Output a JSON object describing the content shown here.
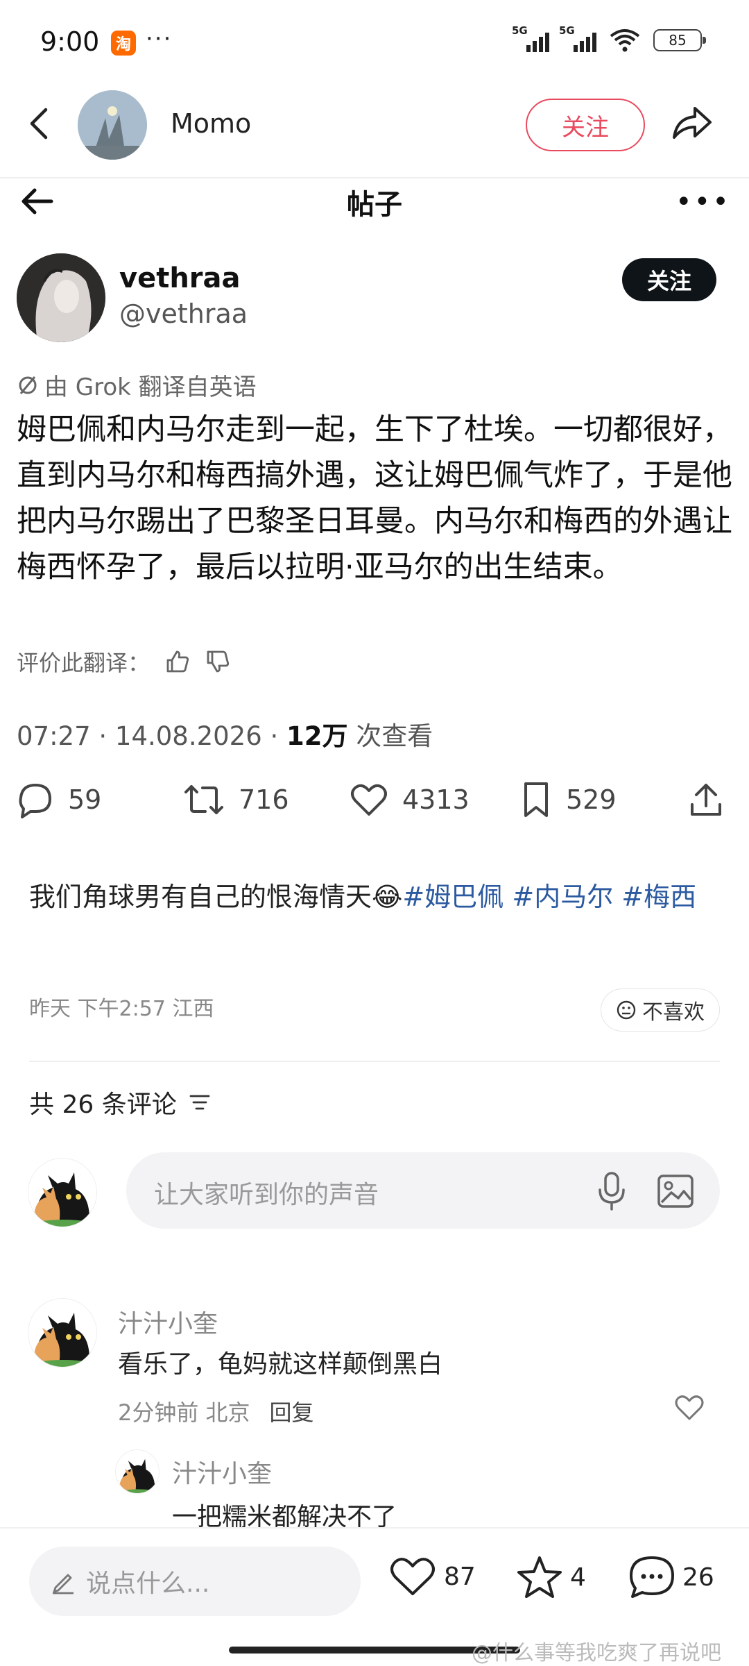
{
  "status_bar": {
    "time": "9:00",
    "app_icon_text": "淘",
    "more": "···",
    "net1": "5G",
    "net2": "5G",
    "battery": "85"
  },
  "header": {
    "name": "Momo",
    "follow_label": "关注"
  },
  "post": {
    "topbar_title": "帖子",
    "more": "•••",
    "author_name": "vethraa",
    "author_handle": "@vethraa",
    "follow_label": "关注",
    "translate_note": "由 Grok 翻译自英语",
    "body": "姆巴佩和内马尔走到一起，生下了杜埃。一切都很好，直到内马尔和梅西搞外遇，这让姆巴佩气炸了，于是他把内马尔踢出了巴黎圣日耳曼。内马尔和梅西的外遇让梅西怀孕了，最后以拉明·亚马尔的出生结束。",
    "rate_label": "评价此翻译：",
    "meta_time": "07:27 · 14.08.2026 · ",
    "meta_views": "12万",
    "meta_views_suffix": " 次查看",
    "replies": "59",
    "reposts": "716",
    "likes": "4313",
    "bookmarks": "529"
  },
  "weibo": {
    "text_prefix": "我们角球男有自己的恨海情天",
    "emoji": "😂",
    "tag1": "#姆巴佩",
    "tag2": "#内马尔",
    "tag3": "#梅西",
    "time": "昨天 下午2:57 江西",
    "dislike_label": "不喜欢",
    "comment_count": "共 26 条评论",
    "input_placeholder": "让大家听到你的声音"
  },
  "comments": [
    {
      "name": "汁汁小奎",
      "text": "看乐了，龟妈就这样颠倒黑白",
      "time": "2分钟前 北京",
      "reply_label": "回复"
    },
    {
      "name": "汁汁小奎",
      "text": "一把糯米都解决不了"
    }
  ],
  "bottom_bar": {
    "placeholder": "说点什么...",
    "likes": "87",
    "favorites": "4",
    "comments": "26"
  },
  "watermark": "@什么事等我吃爽了再说吧"
}
